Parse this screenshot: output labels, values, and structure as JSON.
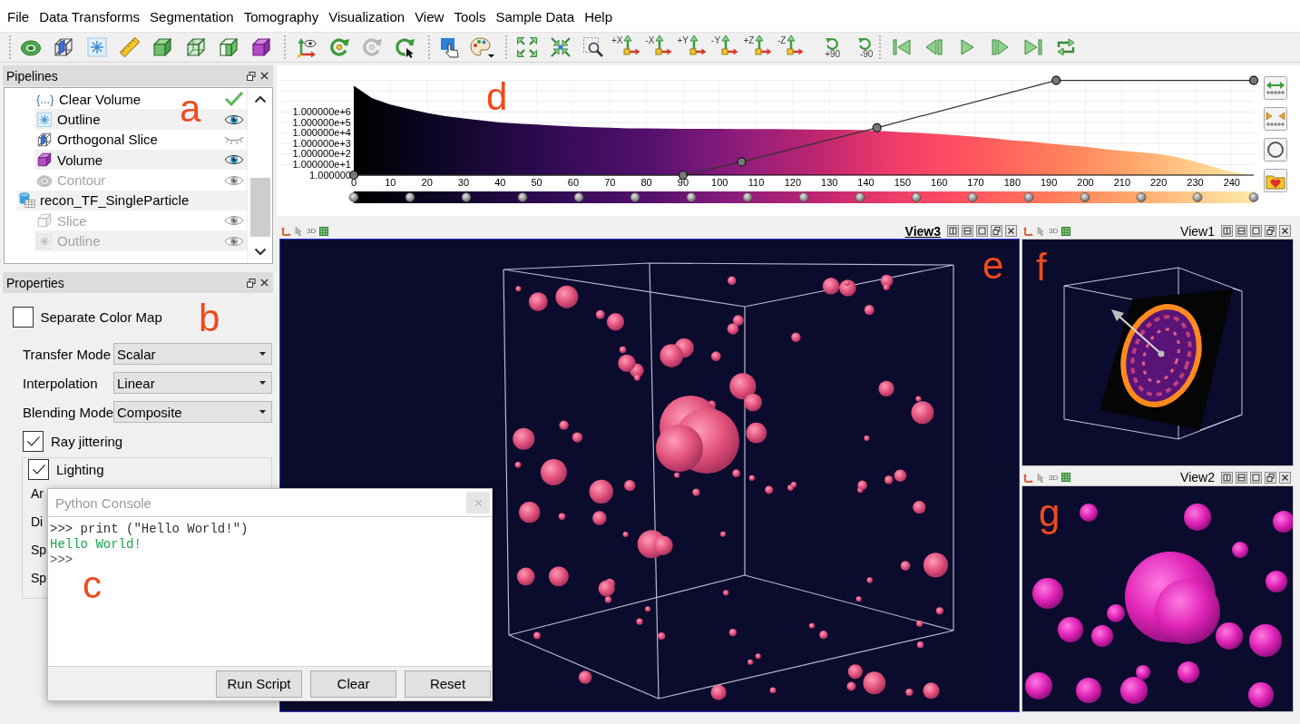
{
  "menu": [
    "File",
    "Data Transforms",
    "Segmentation",
    "Tomography",
    "Visualization",
    "View",
    "Tools",
    "Sample Data",
    "Help"
  ],
  "toolbar": [
    {
      "buttons": [
        {
          "kind": "contour"
        },
        {
          "kind": "orthogonal-slice"
        },
        {
          "kind": "outline"
        },
        {
          "kind": "ruler"
        },
        {
          "kind": "cube"
        },
        {
          "kind": "wire-cube"
        },
        {
          "kind": "split-cube"
        },
        {
          "kind": "volume"
        }
      ]
    },
    {
      "buttons": [
        {
          "kind": "axes",
          "disabled": false
        },
        {
          "kind": "orbit",
          "disabled": false
        },
        {
          "kind": "orbit",
          "disabled": true
        },
        {
          "kind": "orbit-cursor",
          "disabled": false
        }
      ]
    },
    {
      "buttons": [
        {
          "kind": "pointer"
        },
        {
          "kind": "palette"
        }
      ]
    },
    {
      "buttons": [
        {
          "kind": "expand"
        },
        {
          "kind": "collapse"
        },
        {
          "kind": "zoom-box"
        },
        {
          "kind": "axis",
          "label": "+X"
        },
        {
          "kind": "axis",
          "label": "-X"
        },
        {
          "kind": "axis",
          "label": "+Y"
        },
        {
          "kind": "axis",
          "label": "-Y"
        },
        {
          "kind": "axis",
          "label": "+Z"
        },
        {
          "kind": "axis",
          "label": "-Z"
        },
        {
          "kind": "rotate",
          "label": "+90"
        },
        {
          "kind": "rotate",
          "label": "-90"
        }
      ]
    },
    {
      "buttons": [
        {
          "kind": "first"
        },
        {
          "kind": "previous"
        },
        {
          "kind": "play"
        },
        {
          "kind": "next"
        },
        {
          "kind": "last"
        },
        {
          "kind": "loop"
        }
      ]
    }
  ],
  "pipelines": {
    "title": "Pipelines",
    "annotation": "a",
    "items": [
      {
        "kind": "operator",
        "glyph": "{...}",
        "label": "Clear Volume",
        "complete": true
      },
      {
        "kind": "outline",
        "label": "Outline",
        "visible": true,
        "dimmed": false
      },
      {
        "kind": "orthogonal-slice",
        "label": "Orthogonal Slice",
        "visible": false,
        "dimmed": false
      },
      {
        "kind": "volume",
        "label": "Volume",
        "visible": true,
        "dimmed": false
      },
      {
        "kind": "contour",
        "label": "Contour",
        "visible": true,
        "dimmed": true
      },
      {
        "kind": "data-source",
        "label": "recon_TF_SingleParticle",
        "children": [
          {
            "kind": "slice",
            "label": "Slice",
            "visible": true,
            "dimmed": true
          },
          {
            "kind": "outline",
            "label": "Outline",
            "visible": true,
            "dimmed": true
          }
        ]
      }
    ]
  },
  "properties": {
    "title": "Properties",
    "annotation": "b",
    "separate_color_map": {
      "label": "Separate Color Map",
      "checked": false
    },
    "fields": [
      {
        "label": "Transfer Mode",
        "value": "Scalar"
      },
      {
        "label": "Interpolation",
        "value": "Linear"
      },
      {
        "label": "Blending Mode",
        "value": "Composite"
      }
    ],
    "ray_jittering": {
      "label": "Ray jittering",
      "checked": true
    },
    "lighting": {
      "label": "Lighting",
      "checked": true,
      "rows": [
        "Ar",
        "Di",
        "Sp",
        "Sp"
      ]
    }
  },
  "histogram": {
    "annotation": "d",
    "y_labels": [
      "1.000000e+6",
      "1.000000e+5",
      "1.000000e+4",
      "1.000000e+3",
      "1.000000e+2",
      "1.000000e+1",
      "1.000000"
    ],
    "x_labels": [
      "0",
      "10",
      "20",
      "30",
      "40",
      "50",
      "60",
      "70",
      "80",
      "90",
      "100",
      "110",
      "120",
      "130",
      "140",
      "150",
      "160",
      "170",
      "180",
      "190",
      "200",
      "210",
      "220",
      "230",
      "240"
    ]
  },
  "views": [
    {
      "title": "View3",
      "selected": true,
      "mode": "3D",
      "kind": "particles",
      "annotation": "e"
    },
    {
      "title": "View1",
      "selected": false,
      "mode": "3D",
      "kind": "slice",
      "annotation": "f"
    },
    {
      "title": "View2",
      "selected": false,
      "mode": "3D",
      "kind": "closeup",
      "annotation": "g"
    }
  ],
  "console": {
    "title": "Python Console",
    "annotation": "c",
    "lines": [
      {
        "kind": "input",
        "text": ">>> print (\"Hello World!\")"
      },
      {
        "kind": "output",
        "text": "Hello World!"
      },
      {
        "kind": "prompt",
        "text": ">>>"
      }
    ],
    "buttons": [
      "Run Script",
      "Clear",
      "Reset"
    ]
  }
}
